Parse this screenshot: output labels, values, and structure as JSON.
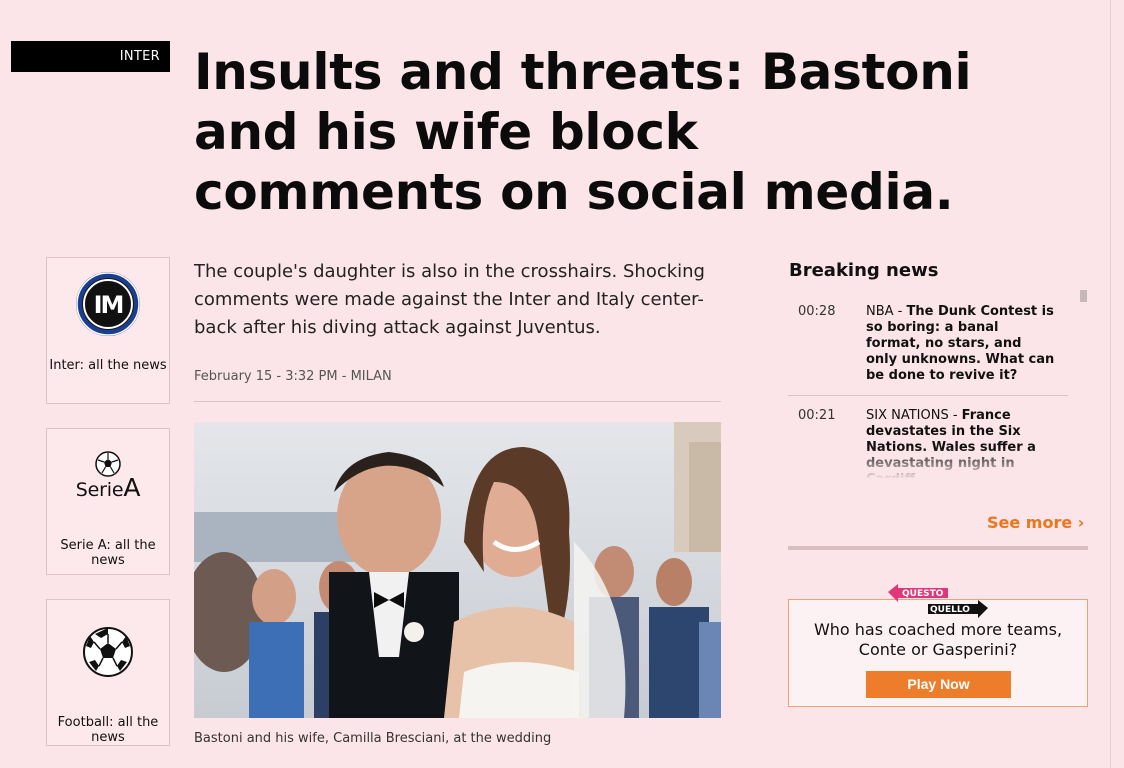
{
  "section": {
    "tag": "INTER"
  },
  "article": {
    "headline": "Insults and threats: Bastoni and his wife block comments on social media.",
    "standfirst": "The couple's daughter is also in the crosshairs. Shocking comments were made against the Inter and Italy center-back after his diving attack against Juventus.",
    "dateline": "February 15 - 3:32 PM - MILAN",
    "caption": "Bastoni and his wife, Camilla Bresciani, at the wedding"
  },
  "sidebar": {
    "cards": [
      {
        "label": "Inter: all the news",
        "icon": "inter-logo-icon"
      },
      {
        "label": "Serie A: all the news",
        "icon": "serie-a-logo-icon",
        "logo_text_a": "Serie",
        "logo_text_b": "A"
      },
      {
        "label": "Football: all the news",
        "icon": "football-icon"
      }
    ]
  },
  "breaking": {
    "title": "Breaking news",
    "items": [
      {
        "time": "00:28",
        "category": "NBA - ",
        "text": "The Dunk Contest is so boring: a banal format, no stars, and only unknowns. What can be done to revive it?"
      },
      {
        "time": "00:21",
        "category": "SIX NATIONS - ",
        "text": "France devastates in the Six Nations. Wales suffer a devastating night in Cardiff"
      }
    ],
    "see_more": "See more ›"
  },
  "quiz": {
    "logo_top": "QUESTO",
    "logo_bottom": "QUELLO",
    "question": "Who has coached more teams, Conte or Gasperini?",
    "button": "Play Now"
  },
  "colors": {
    "accent_orange": "#ee7d2b",
    "background": "#fbe5e8",
    "inter_blue": "#1b3f8f"
  }
}
